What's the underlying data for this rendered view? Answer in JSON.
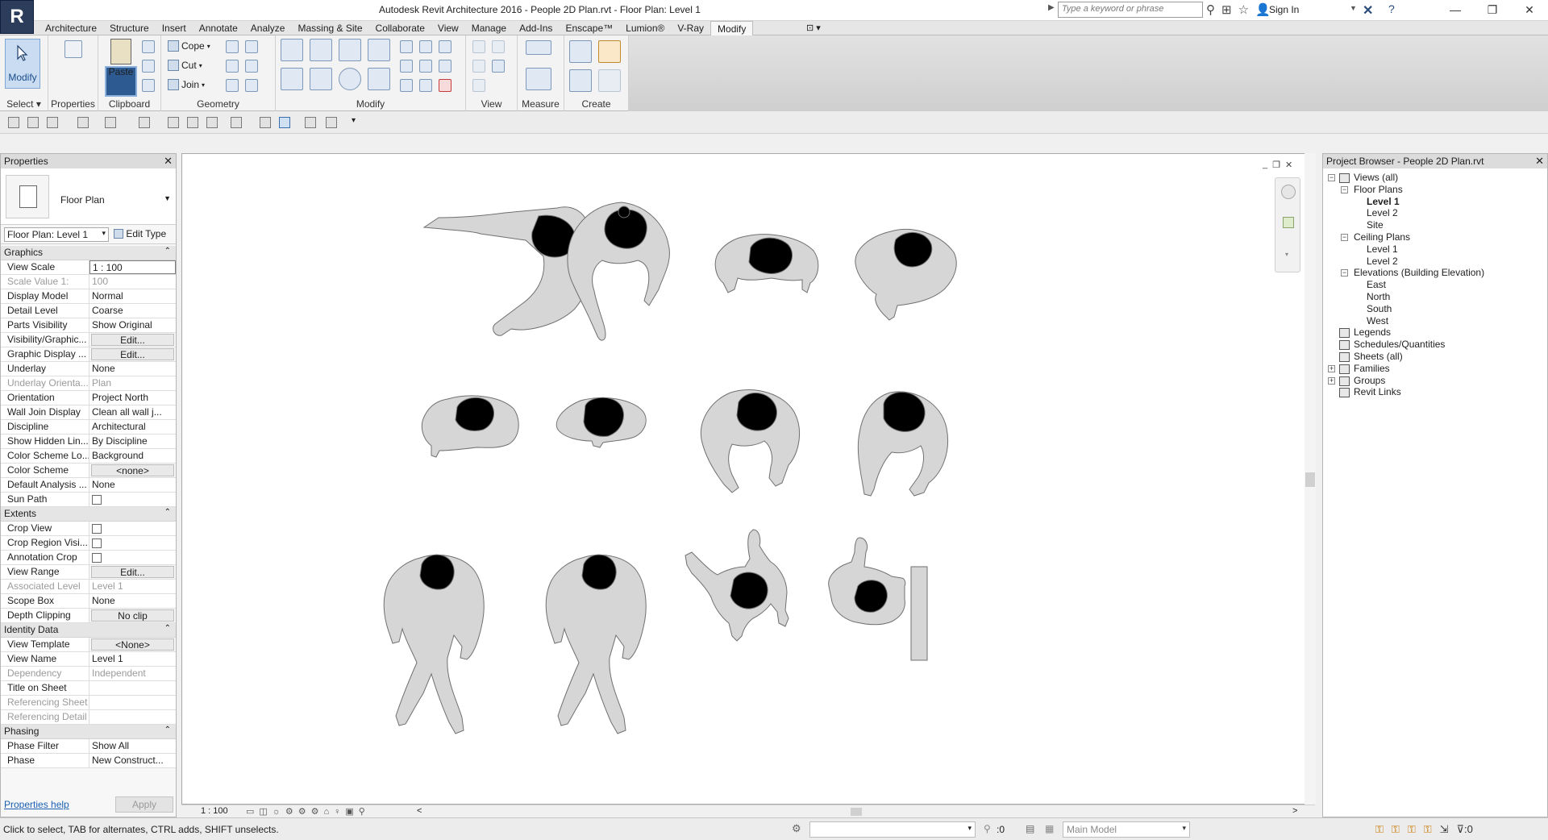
{
  "app": {
    "logo_letter": "R",
    "window_title": "Autodesk Revit Architecture 2016 -    People 2D Plan.rvt - Floor Plan: Level 1",
    "search_placeholder": "Type a keyword or phrase",
    "sign_in": "Sign In"
  },
  "ribbon": {
    "tabs": [
      "Architecture",
      "Structure",
      "Insert",
      "Annotate",
      "Analyze",
      "Massing & Site",
      "Collaborate",
      "View",
      "Manage",
      "Add-Ins",
      "Enscape™",
      "Lumion®",
      "V-Ray",
      "Modify"
    ],
    "active_tab": "Modify",
    "modify_label": "Modify",
    "select_label": "Select ▾",
    "properties_label": "Properties",
    "paste_label": "Paste",
    "clipboard_label": "Clipboard",
    "cope_label": "Cope",
    "cut_label": "Cut",
    "join_label": "Join",
    "geometry_label": "Geometry",
    "modify_panel_label": "Modify",
    "view_label": "View",
    "measure_label": "Measure",
    "create_label": "Create"
  },
  "properties": {
    "title": "Properties",
    "type_name": "Floor Plan",
    "instance_selector": "Floor Plan: Level 1",
    "edit_type": "Edit Type",
    "groups": [
      {
        "name": "Graphics",
        "rows": [
          {
            "k": "View Scale",
            "v": "1 : 100",
            "style": "sel"
          },
          {
            "k": "Scale Value    1:",
            "v": "100",
            "style": "dim"
          },
          {
            "k": "Display Model",
            "v": "Normal"
          },
          {
            "k": "Detail Level",
            "v": "Coarse"
          },
          {
            "k": "Parts Visibility",
            "v": "Show Original"
          },
          {
            "k": "Visibility/Graphic...",
            "v": "Edit...",
            "style": "btn"
          },
          {
            "k": "Graphic Display ...",
            "v": "Edit...",
            "style": "btn"
          },
          {
            "k": "Underlay",
            "v": "None"
          },
          {
            "k": "Underlay Orienta...",
            "v": "Plan",
            "style": "dim"
          },
          {
            "k": "Orientation",
            "v": "Project North"
          },
          {
            "k": "Wall Join Display",
            "v": "Clean all wall j..."
          },
          {
            "k": "Discipline",
            "v": "Architectural"
          },
          {
            "k": "Show Hidden Lin...",
            "v": "By Discipline"
          },
          {
            "k": "Color Scheme Lo...",
            "v": "Background"
          },
          {
            "k": "Color Scheme",
            "v": "<none>",
            "style": "btn"
          },
          {
            "k": "Default Analysis ...",
            "v": "None"
          },
          {
            "k": "Sun Path",
            "v": "",
            "style": "check"
          }
        ]
      },
      {
        "name": "Extents",
        "rows": [
          {
            "k": "Crop View",
            "v": "",
            "style": "check"
          },
          {
            "k": "Crop Region Visi...",
            "v": "",
            "style": "check"
          },
          {
            "k": "Annotation Crop",
            "v": "",
            "style": "check"
          },
          {
            "k": "View Range",
            "v": "Edit...",
            "style": "btn"
          },
          {
            "k": "Associated Level",
            "v": "Level 1",
            "style": "dim"
          },
          {
            "k": "Scope Box",
            "v": "None"
          },
          {
            "k": "Depth Clipping",
            "v": "No clip",
            "style": "btn"
          }
        ]
      },
      {
        "name": "Identity Data",
        "rows": [
          {
            "k": "View Template",
            "v": "<None>",
            "style": "btn"
          },
          {
            "k": "View Name",
            "v": "Level 1"
          },
          {
            "k": "Dependency",
            "v": "Independent",
            "style": "dim"
          },
          {
            "k": "Title on Sheet",
            "v": ""
          },
          {
            "k": "Referencing Sheet",
            "v": "",
            "style": "dim"
          },
          {
            "k": "Referencing Detail",
            "v": "",
            "style": "dim"
          }
        ]
      },
      {
        "name": "Phasing",
        "rows": [
          {
            "k": "Phase Filter",
            "v": "Show All"
          },
          {
            "k": "Phase",
            "v": "New Construct..."
          }
        ]
      }
    ],
    "help_link": "Properties help",
    "apply": "Apply"
  },
  "view_bar": {
    "scale": "1 : 100"
  },
  "project_browser": {
    "title": "Project Browser - People 2D Plan.rvt",
    "nodes": [
      {
        "label": "Views (all)",
        "level": 0,
        "toggle": "−",
        "icon": true
      },
      {
        "label": "Floor Plans",
        "level": 1,
        "toggle": "−"
      },
      {
        "label": "Level 1",
        "level": 2,
        "bold": true
      },
      {
        "label": "Level 2",
        "level": 2
      },
      {
        "label": "Site",
        "level": 2
      },
      {
        "label": "Ceiling Plans",
        "level": 1,
        "toggle": "−"
      },
      {
        "label": "Level 1",
        "level": 2
      },
      {
        "label": "Level 2",
        "level": 2
      },
      {
        "label": "Elevations (Building Elevation)",
        "level": 1,
        "toggle": "−"
      },
      {
        "label": "East",
        "level": 2
      },
      {
        "label": "North",
        "level": 2
      },
      {
        "label": "South",
        "level": 2
      },
      {
        "label": "West",
        "level": 2
      },
      {
        "label": "Legends",
        "level": 0,
        "icon": true
      },
      {
        "label": "Schedules/Quantities",
        "level": 0,
        "icon": true
      },
      {
        "label": "Sheets (all)",
        "level": 0,
        "icon": true
      },
      {
        "label": "Families",
        "level": 0,
        "toggle": "+",
        "icon": true
      },
      {
        "label": "Groups",
        "level": 0,
        "toggle": "+",
        "icon": true
      },
      {
        "label": "Revit Links",
        "level": 0,
        "icon": true
      }
    ]
  },
  "status": {
    "hint": "Click to select, TAB for alternates, CTRL adds, SHIFT unselects.",
    "counter": ":0",
    "model": "Main Model",
    "filter_count": ":0"
  }
}
